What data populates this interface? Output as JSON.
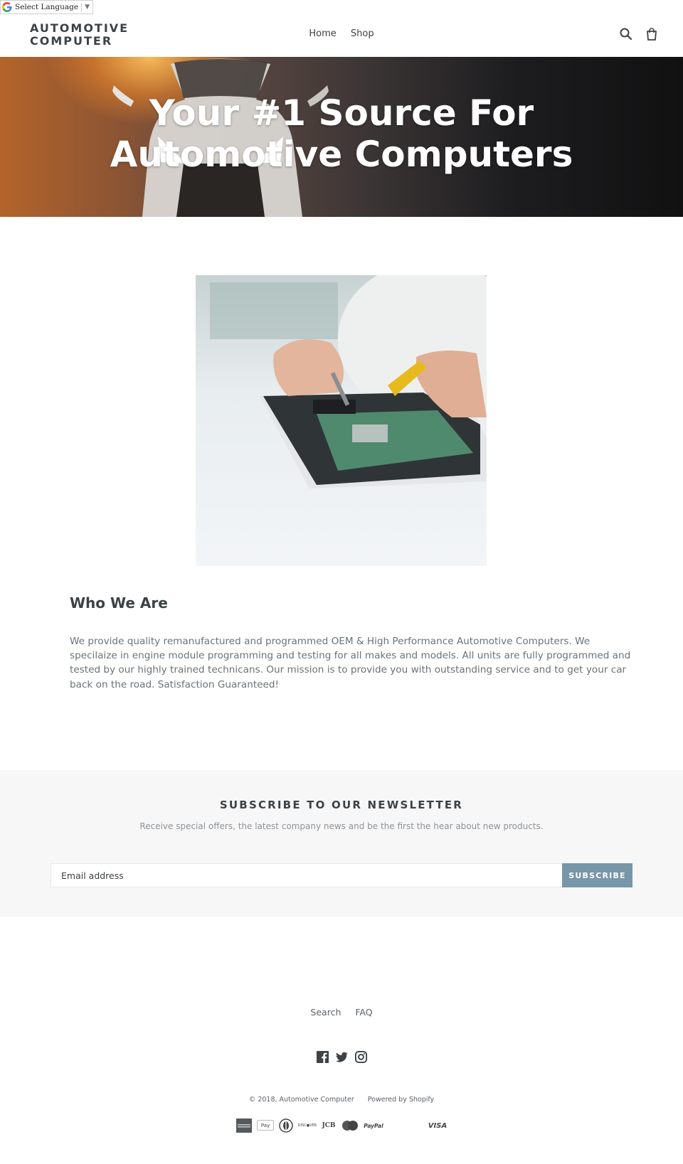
{
  "translate_widget": {
    "label": "Select Language",
    "arrow": "▼"
  },
  "header": {
    "logo_line1": "AUTOMOTIVE",
    "logo_line2": "COMPUTER",
    "nav": [
      {
        "label": "Home"
      },
      {
        "label": "Shop"
      }
    ],
    "icons": {
      "search": "search-icon",
      "cart": "cart-icon"
    }
  },
  "hero": {
    "title_line1": "Your #1 Source For",
    "title_line2": "Automotive Computers"
  },
  "about": {
    "image_alt": "Technician repairing circuit board",
    "title": "Who We Are",
    "text": "We provide quality remanufactured and programmed OEM & High Performance Automotive Computers. We specilaize in engine module programming and testing for all makes and models. All units are fully programmed and tested by our highly trained technicans. Our mission is to provide you with outstanding service and to get your car back on the road. Satisfaction Guaranteed!"
  },
  "newsletter": {
    "title": "SUBSCRIBE TO OUR NEWSLETTER",
    "subtitle": "Receive special offers, the latest company news and be the first the hear about new products.",
    "email_placeholder": "Email address",
    "email_value": "",
    "button_label": "SUBSCRIBE",
    "button_color": "#7796a8"
  },
  "footer": {
    "links": [
      {
        "label": "Search"
      },
      {
        "label": "FAQ"
      }
    ],
    "social": [
      "facebook-icon",
      "twitter-icon",
      "instagram-icon"
    ],
    "copyright": "© 2018, Automotive Computer",
    "powered_by": "Powered by Shopify",
    "payment_methods": [
      "American Express",
      "Apple Pay",
      "Diners Club",
      "Discover",
      "JCB",
      "Master",
      "PayPal",
      "Visa"
    ],
    "payment_labels": {
      "discover": "DISC●VER",
      "jcb": "JCB",
      "paypal": "PayPal",
      "visa": "VISA",
      "applepay": "Pay"
    }
  }
}
